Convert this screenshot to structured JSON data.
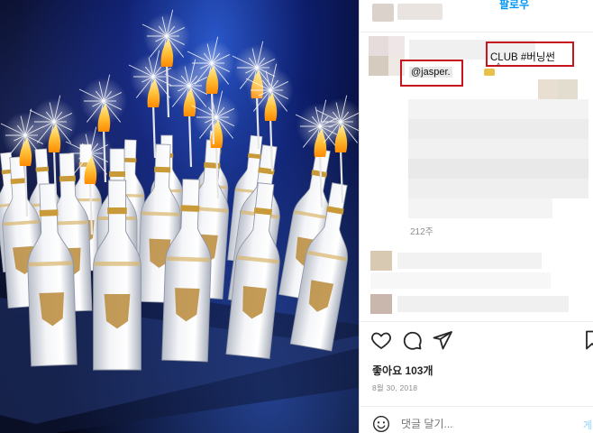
{
  "post": {
    "image_alt_icon": "nightclub-photo-illustration",
    "header": {
      "follow_label": "팔로우"
    },
    "caption": {
      "mention_text": "@jasper.",
      "tag_text": "CLUB #버닝썬",
      "caret": "^"
    },
    "comment_time": "212주",
    "actions": {
      "like_icon": "heart-icon",
      "comment_icon": "comment-icon",
      "share_icon": "send-icon",
      "save_icon": "bookmark-icon"
    },
    "likes_text": "좋아요 103개",
    "date_text": "8월 30, 2018",
    "comment": {
      "placeholder": "댓글 달기...",
      "post_label": "게"
    }
  },
  "colors": {
    "highlight_box": "#c8141d",
    "link_blue": "#0095f6",
    "muted_text": "#8e8e8e"
  }
}
